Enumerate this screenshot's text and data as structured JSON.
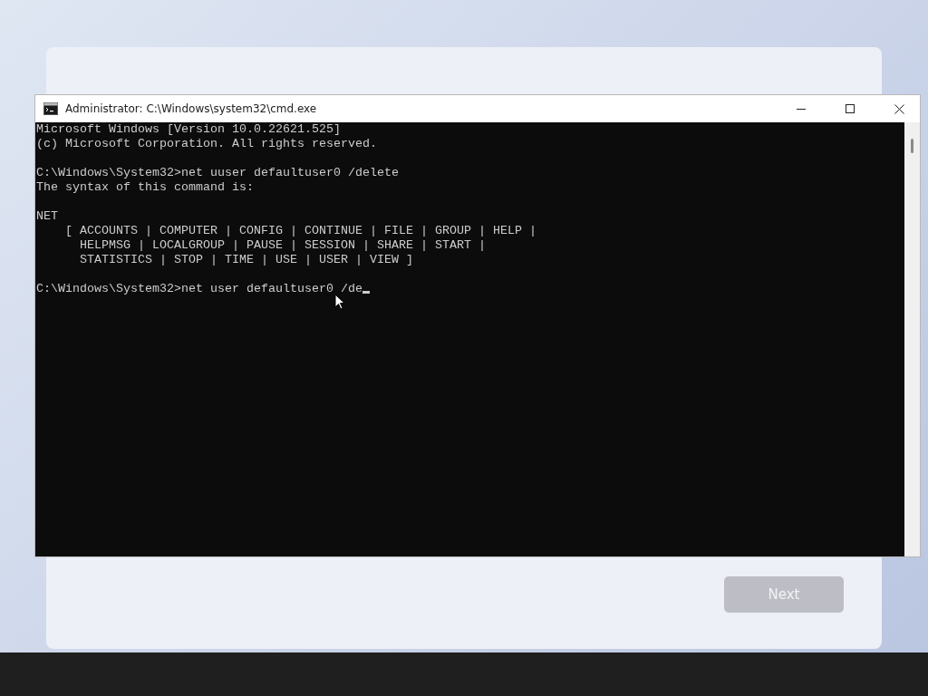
{
  "window": {
    "title": "Administrator: C:\\Windows\\system32\\cmd.exe"
  },
  "console": {
    "blocks": [
      [
        "Microsoft Windows [Version 10.0.22621.525]",
        "(c) Microsoft Corporation. All rights reserved."
      ],
      [
        "C:\\Windows\\System32>net uuser defaultuser0 /delete",
        "The syntax of this command is:"
      ],
      [
        "NET",
        "    [ ACCOUNTS | COMPUTER | CONFIG | CONTINUE | FILE | GROUP | HELP |",
        "      HELPMSG | LOCALGROUP | PAUSE | SESSION | SHARE | START |",
        "      STATISTICS | STOP | TIME | USE | USER | VIEW ]"
      ],
      [
        "C:\\Windows\\System32>net user defaultuser0 /de"
      ]
    ],
    "cursor": true
  },
  "next_button": {
    "label": "Next",
    "disabled": true
  }
}
